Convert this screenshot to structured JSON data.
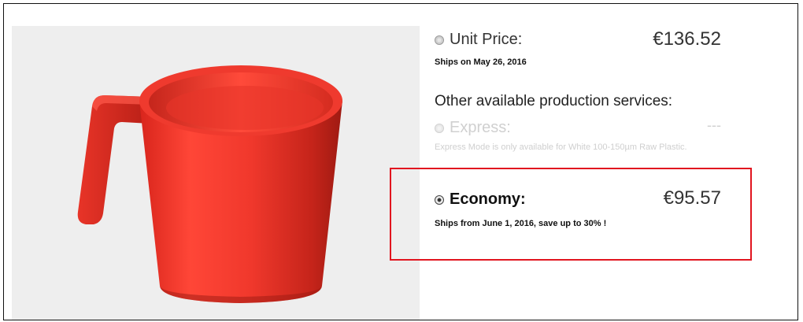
{
  "product": {
    "image_alt": "Red 3D printed mug",
    "accent_color": "#e83a2f"
  },
  "pricing": {
    "unit": {
      "label": "Unit Price:",
      "price": "€136.52",
      "ship_note": "Ships on May 26, 2016",
      "selected": false
    },
    "other_services_title": "Other available production services:",
    "express": {
      "label": "Express:",
      "price": "---",
      "note": "Express Mode is only available for White 100-150µm Raw Plastic.",
      "enabled": false
    },
    "economy": {
      "label": "Economy:",
      "price": "€95.57",
      "ship_note": "Ships from June 1, 2016, save up to 30% !",
      "selected": true
    }
  },
  "colors": {
    "highlight_border": "#e1151f",
    "preview_background": "#eeeeee",
    "disabled_text": "#d0d0d0"
  }
}
